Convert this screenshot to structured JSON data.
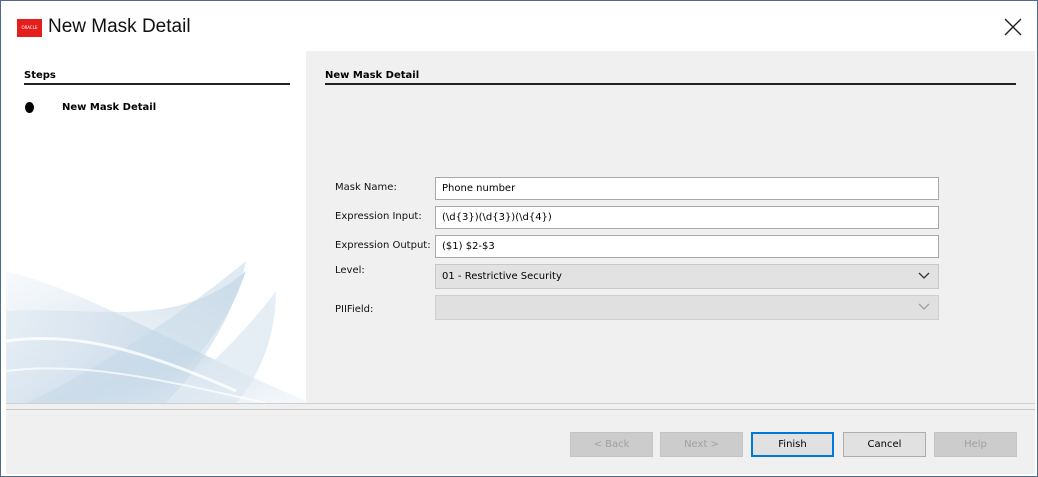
{
  "window": {
    "title": "New Mask Detail",
    "logo_text": "ORACLE"
  },
  "steps": {
    "header": "Steps",
    "items": [
      {
        "label": "New Mask Detail"
      }
    ]
  },
  "form": {
    "section_title": "New Mask Detail",
    "fields": {
      "mask_name": {
        "label": "Mask Name:",
        "value": "Phone number"
      },
      "expression_input": {
        "label": "Expression Input:",
        "value": "(\\d{3})(\\d{3})(\\d{4})"
      },
      "expression_output": {
        "label": "Expression Output:",
        "value": "($1) $2-$3"
      },
      "level": {
        "label": "Level:",
        "selected": "01 - Restrictive Security"
      },
      "pii_field": {
        "label": "PIIField:",
        "selected": ""
      }
    }
  },
  "buttons": {
    "back": "< Back",
    "next": "Next >",
    "finish": "Finish",
    "cancel": "Cancel",
    "help": "Help"
  },
  "colors": {
    "accent": "#0078d7",
    "logo_red": "#e41d1d",
    "panel_bg": "#f0f0f0"
  }
}
